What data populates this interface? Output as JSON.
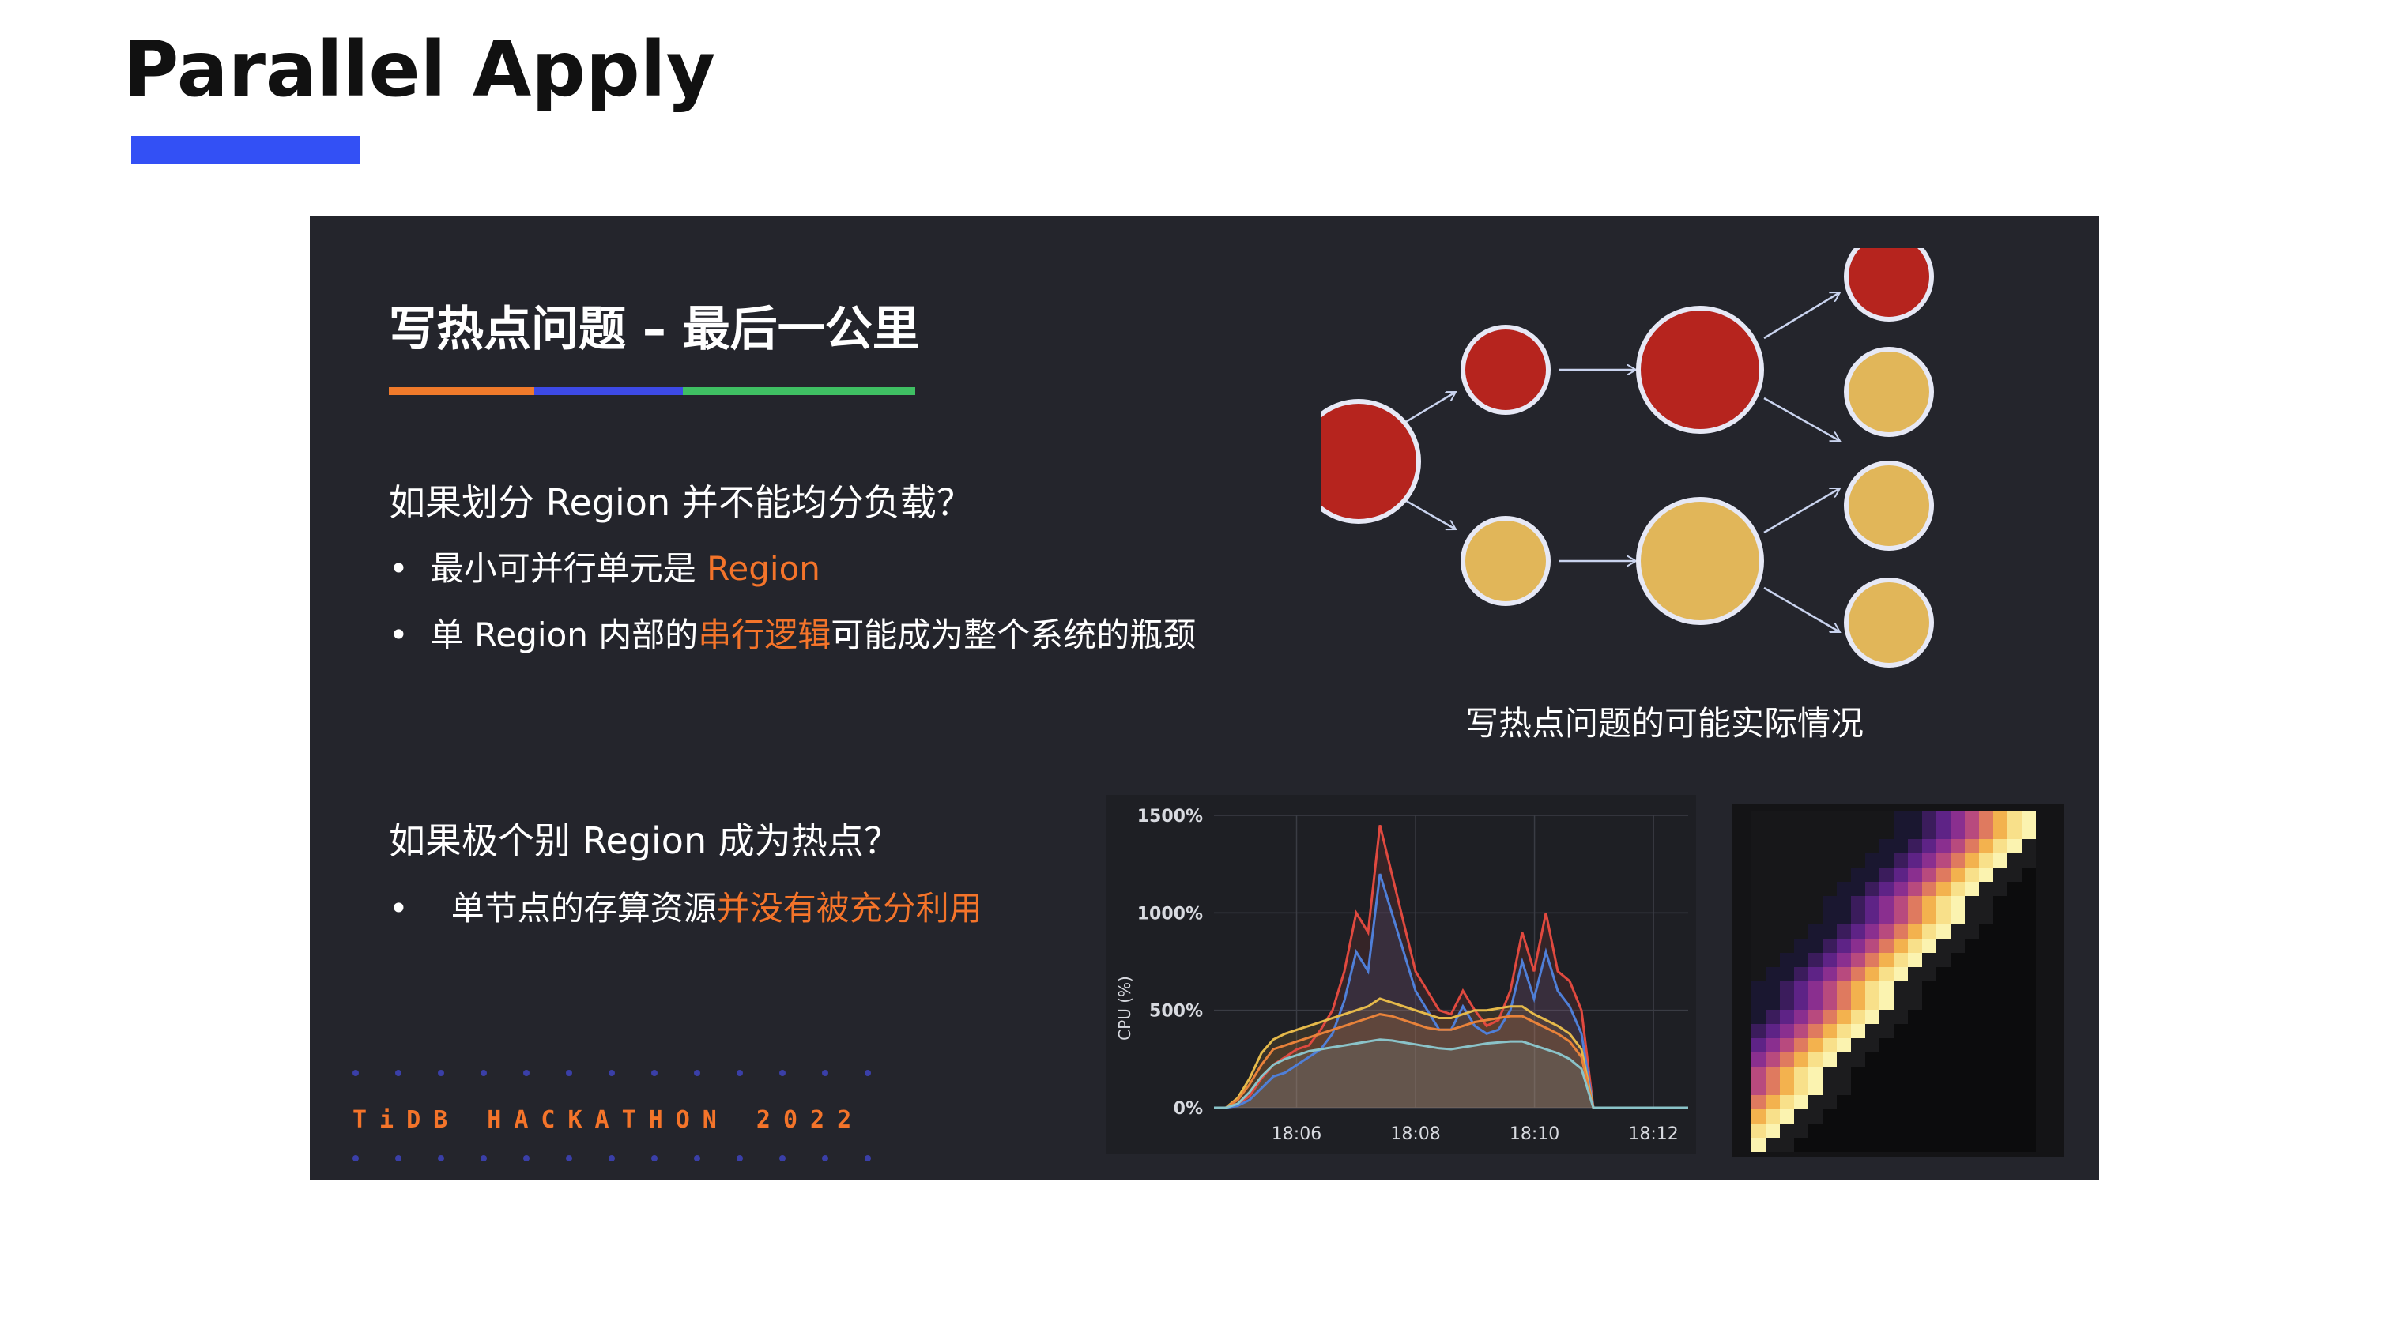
{
  "page": {
    "title": "Parallel Apply",
    "accent_color": "#3350f5"
  },
  "slide": {
    "heading": "写热点问题 – 最后一公里",
    "q1": "如果划分 Region 并不能均分负载？",
    "b1_prefix": "最小可并行单元是 ",
    "b1_highlight": "Region",
    "b2_prefix": "单 Region 内部的",
    "b2_highlight": "串行逻辑",
    "b2_suffix": "可能成为整个系统的瓶颈",
    "q2": "如果极个别 Region 成为热点？",
    "b3_prefix": "单节点的存算资源",
    "b3_highlight": "并没有被充分利用",
    "bullet_char": "•",
    "highlight_color": "#f4742a",
    "logo_text": "TiDB HACKATHON 2022",
    "diagram_caption": "写热点问题的可能实际情况"
  },
  "chart_data": {
    "type": "line",
    "title": "",
    "xlabel": "",
    "ylabel": "CPU (%)",
    "ylim": [
      0,
      1500
    ],
    "yticks": [
      "0%",
      "500%",
      "1000%",
      "1500%"
    ],
    "xticks": [
      "18:06",
      "18:08",
      "18:10",
      "18:12"
    ],
    "x": [
      0,
      1,
      2,
      3,
      4,
      5,
      6,
      7,
      8,
      9,
      10,
      11,
      12,
      13,
      14,
      15,
      16,
      17,
      18,
      19,
      20,
      21,
      22,
      23,
      24,
      25,
      26,
      27,
      28,
      29,
      30,
      31,
      32,
      33,
      34,
      35,
      36,
      37,
      38,
      39,
      40
    ],
    "series": [
      {
        "color": "#e0493f",
        "values": [
          0,
          0,
          20,
          60,
          150,
          220,
          260,
          300,
          320,
          400,
          500,
          700,
          1000,
          900,
          1450,
          1200,
          950,
          700,
          600,
          500,
          480,
          600,
          500,
          420,
          450,
          600,
          900,
          700,
          1000,
          700,
          650,
          500,
          0,
          0,
          0,
          0,
          0,
          0,
          0,
          0,
          0
        ]
      },
      {
        "color": "#4f7fd8",
        "values": [
          0,
          0,
          10,
          40,
          100,
          160,
          180,
          220,
          260,
          300,
          380,
          550,
          800,
          700,
          1200,
          1000,
          800,
          600,
          500,
          400,
          400,
          520,
          420,
          380,
          400,
          500,
          750,
          560,
          800,
          600,
          520,
          380,
          0,
          0,
          0,
          0,
          0,
          0,
          0,
          0,
          0
        ]
      },
      {
        "color": "#e5b94a",
        "values": [
          0,
          0,
          50,
          150,
          280,
          350,
          380,
          400,
          420,
          440,
          460,
          480,
          500,
          520,
          560,
          540,
          520,
          500,
          480,
          460,
          460,
          480,
          500,
          500,
          510,
          520,
          520,
          480,
          450,
          420,
          380,
          300,
          0,
          0,
          0,
          0,
          0,
          0,
          0,
          0,
          0
        ]
      },
      {
        "color": "#e8823a",
        "values": [
          0,
          0,
          40,
          120,
          220,
          300,
          320,
          340,
          360,
          380,
          400,
          420,
          440,
          460,
          480,
          470,
          450,
          430,
          410,
          400,
          400,
          420,
          440,
          450,
          460,
          470,
          470,
          440,
          410,
          380,
          340,
          260,
          0,
          0,
          0,
          0,
          0,
          0,
          0,
          0,
          0
        ]
      },
      {
        "color": "#8ac3c9",
        "values": [
          0,
          0,
          20,
          80,
          160,
          220,
          250,
          270,
          290,
          300,
          310,
          320,
          330,
          340,
          350,
          345,
          335,
          325,
          315,
          305,
          300,
          310,
          320,
          330,
          335,
          340,
          340,
          320,
          300,
          280,
          250,
          200,
          0,
          0,
          0,
          0,
          0,
          0,
          0,
          0,
          0
        ]
      }
    ]
  }
}
